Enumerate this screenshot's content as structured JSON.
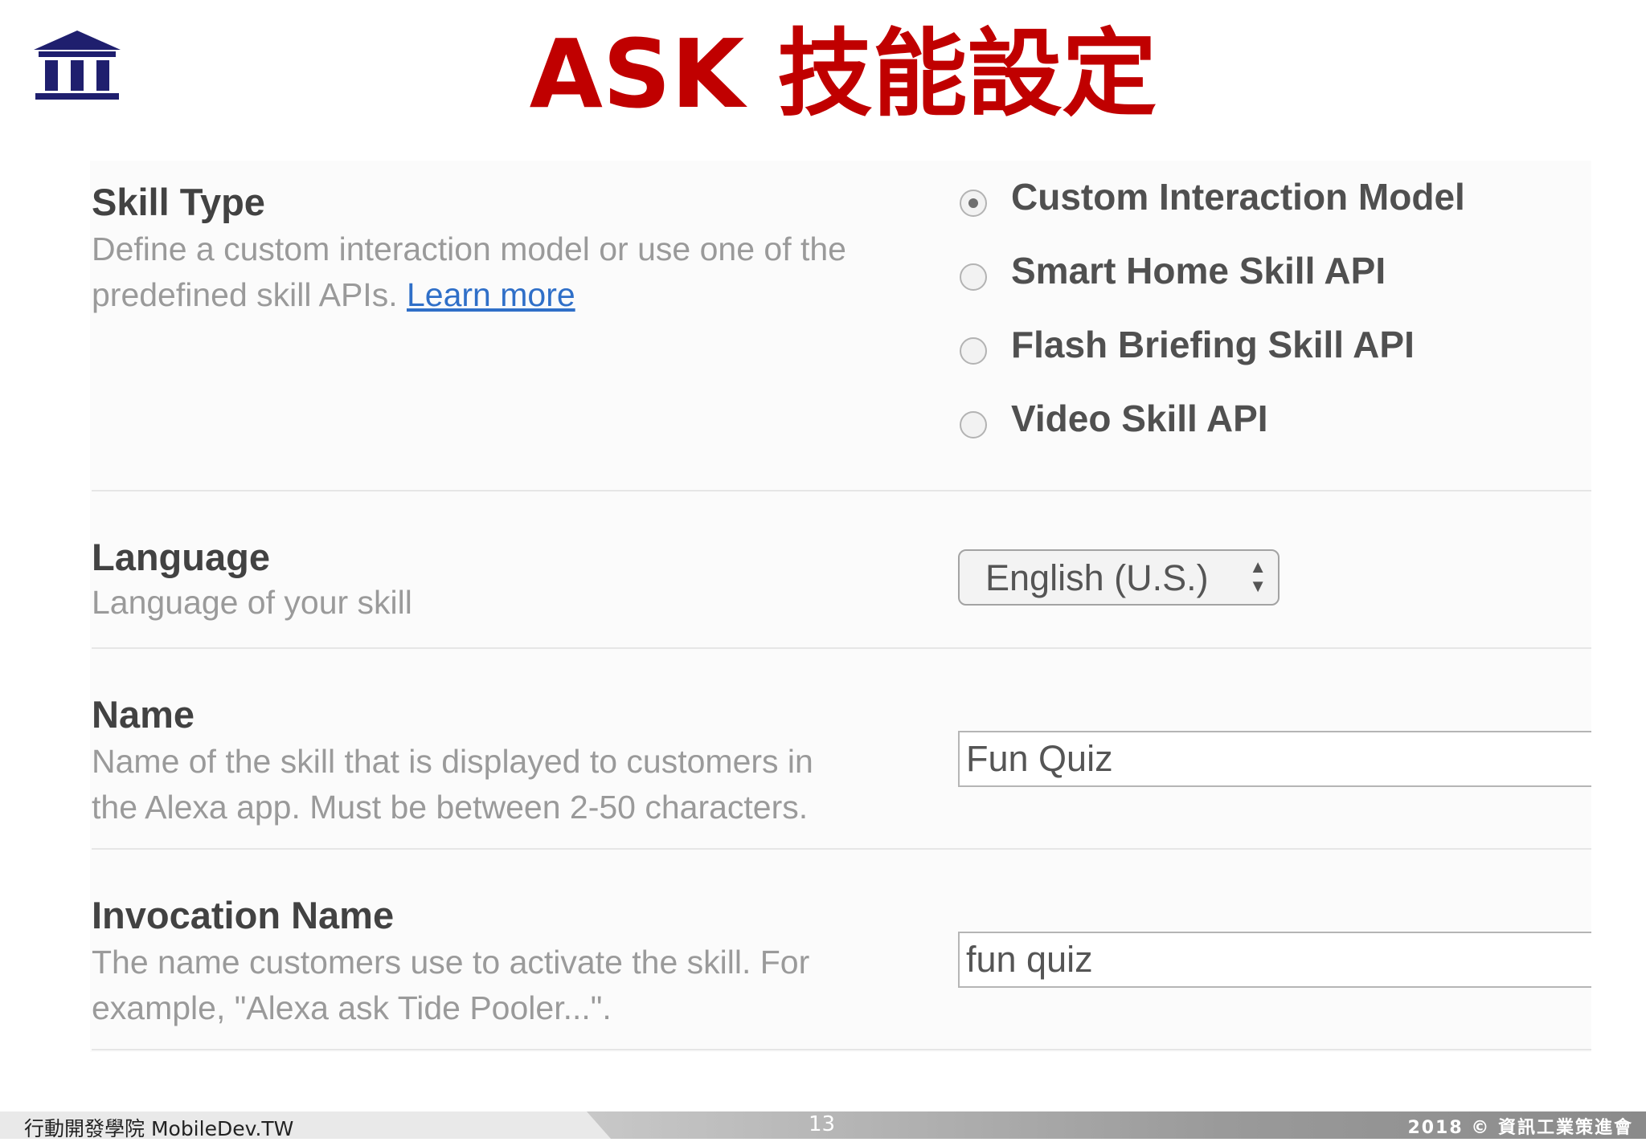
{
  "header": {
    "title": "ASK 技能設定"
  },
  "colors": {
    "title": "#c00000",
    "logo": "#1f1f6e",
    "link": "#2f6fc8"
  },
  "skill_type": {
    "label": "Skill Type",
    "desc_line1": "Define a custom interaction model or use one of the",
    "desc_line2_prefix": "predefined skill APIs. ",
    "learn_more": "Learn more",
    "options": [
      {
        "label": "Custom Interaction Model",
        "selected": true
      },
      {
        "label": "Smart Home Skill API",
        "selected": false
      },
      {
        "label": "Flash Briefing Skill API",
        "selected": false
      },
      {
        "label": "Video Skill API",
        "selected": false
      }
    ]
  },
  "language": {
    "label": "Language",
    "desc": "Language of your skill",
    "selected": "English (U.S.)"
  },
  "name": {
    "label": "Name",
    "desc_line1": "Name of the skill that is displayed to customers in",
    "desc_line2": "the Alexa app. Must be between 2-50 characters.",
    "value": "Fun Quiz"
  },
  "invocation": {
    "label": "Invocation Name",
    "desc_line1": "The name customers use to activate the skill. For",
    "desc_line2": "example, \"Alexa ask Tide Pooler...\".",
    "value": "fun quiz"
  },
  "footer": {
    "left": "行動開發學院 MobileDev.TW",
    "page": "13",
    "right": "2018 © 資訊工業策進會"
  }
}
